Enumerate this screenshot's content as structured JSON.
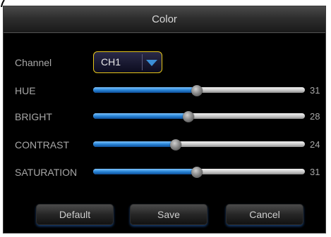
{
  "dialog": {
    "title": "Color"
  },
  "channel": {
    "label": "Channel",
    "selected": "CH1"
  },
  "sliders": [
    {
      "label": "HUE",
      "value": "31",
      "fraction": 0.49
    },
    {
      "label": "BRIGHT",
      "value": "28",
      "fraction": 0.45
    },
    {
      "label": "CONTRAST",
      "value": "24",
      "fraction": 0.39
    },
    {
      "label": "SATURATION",
      "value": "31",
      "fraction": 0.49
    }
  ],
  "buttons": {
    "default_label": "Default",
    "save_label": "Save",
    "cancel_label": "Cancel"
  },
  "colors": {
    "accent_blue": "#2a86d8",
    "focus_yellow": "#e6c619",
    "background": "#000000"
  },
  "icons": {
    "dropdown": "chevron-down-icon"
  }
}
